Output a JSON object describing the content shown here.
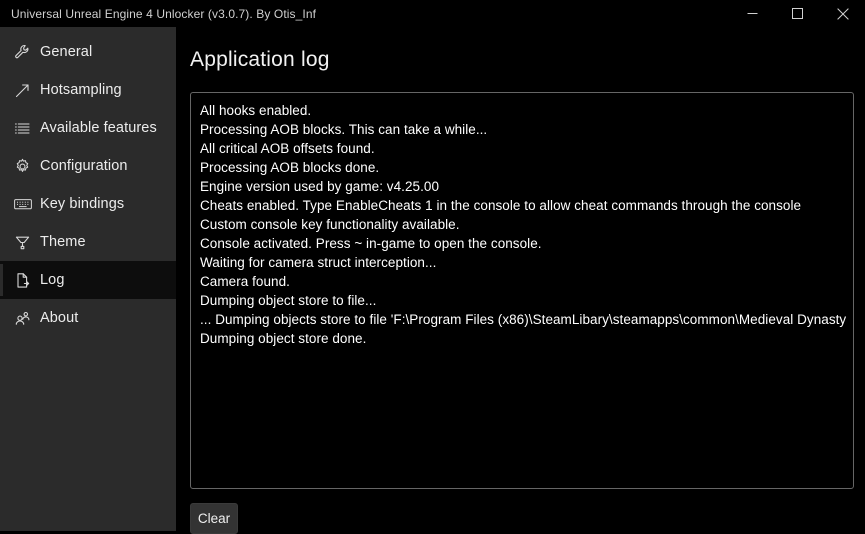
{
  "window": {
    "title": "Universal Unreal Engine 4 Unlocker (v3.0.7). By Otis_Inf",
    "controls": {
      "minimize": "minimize-icon",
      "maximize": "maximize-icon",
      "close": "close-icon"
    }
  },
  "sidebar": {
    "items": [
      {
        "label": "General",
        "icon": "wrench-icon"
      },
      {
        "label": "Hotsampling",
        "icon": "diagonal-arrow-icon"
      },
      {
        "label": "Available features",
        "icon": "list-icon"
      },
      {
        "label": "Configuration",
        "icon": "gear-icon"
      },
      {
        "label": "Key bindings",
        "icon": "keyboard-icon"
      },
      {
        "label": "Theme",
        "icon": "paint-bucket-icon"
      },
      {
        "label": "Log",
        "icon": "document-icon",
        "selected": true
      },
      {
        "label": "About",
        "icon": "people-icon"
      }
    ]
  },
  "main": {
    "title": "Application log",
    "log_lines": [
      "All hooks enabled.",
      "Processing AOB blocks. This can take a while...",
      "All critical AOB offsets found.",
      "Processing AOB blocks done.",
      "Engine version used by game: v4.25.00",
      "Cheats enabled. Type EnableCheats 1 in the console to allow cheat commands through the console",
      "Custom console key functionality available.",
      "Console activated. Press ~ in-game to open the console.",
      "Waiting for camera struct interception...",
      "Camera found.",
      "Dumping object store to file...",
      "... Dumping objects store to file 'F:\\Program Files (x86)\\SteamLibary\\steamapps\\common\\Medieval Dynasty",
      "Dumping object store done."
    ],
    "clear_label": "Clear"
  },
  "colors": {
    "window_background": "#000000",
    "sidebar_background": "#2b2b2b",
    "selected_item_background": "#0d0d0d",
    "log_border": "#666666",
    "button_background": "#333333",
    "text_primary": "#ffffff"
  }
}
